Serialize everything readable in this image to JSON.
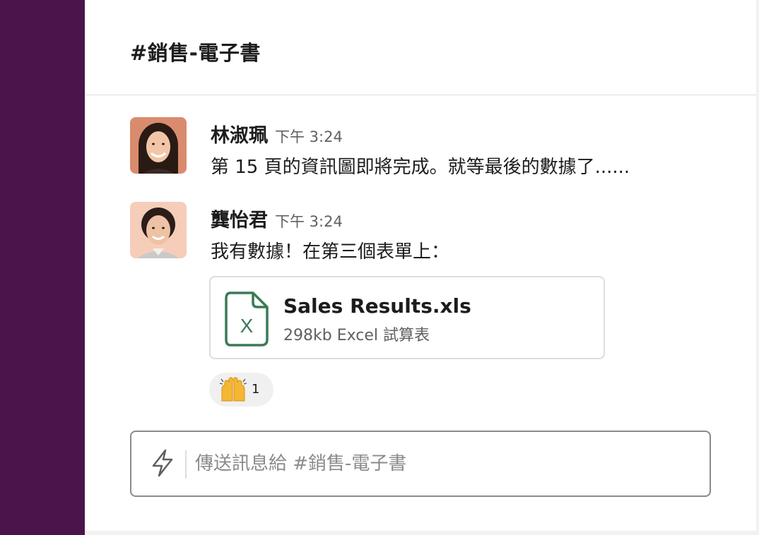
{
  "channel": {
    "title": "#銷售-電子書"
  },
  "messages": [
    {
      "author": "林淑珮",
      "time": "下午 3:24",
      "text": "第 15 頁的資訊圖即將完成。就等最後的數據了......"
    },
    {
      "author": "龔怡君",
      "time": "下午 3:24",
      "text": "我有數據！在第三個表單上："
    }
  ],
  "attachment": {
    "name": "Sales Results.xls",
    "meta": "298kb Excel 試算表",
    "icon_letter": "X",
    "icon": "excel-file-icon"
  },
  "reaction": {
    "emoji": "raised-hands-emoji",
    "count": "1"
  },
  "composer": {
    "placeholder": "傳送訊息給 #銷售-電子書",
    "value": "",
    "shortcut_icon": "lightning-icon"
  },
  "colors": {
    "sidebar": "#4a154b",
    "excel_green": "#3a7a57",
    "text": "#1d1c1d",
    "muted": "#616061"
  }
}
